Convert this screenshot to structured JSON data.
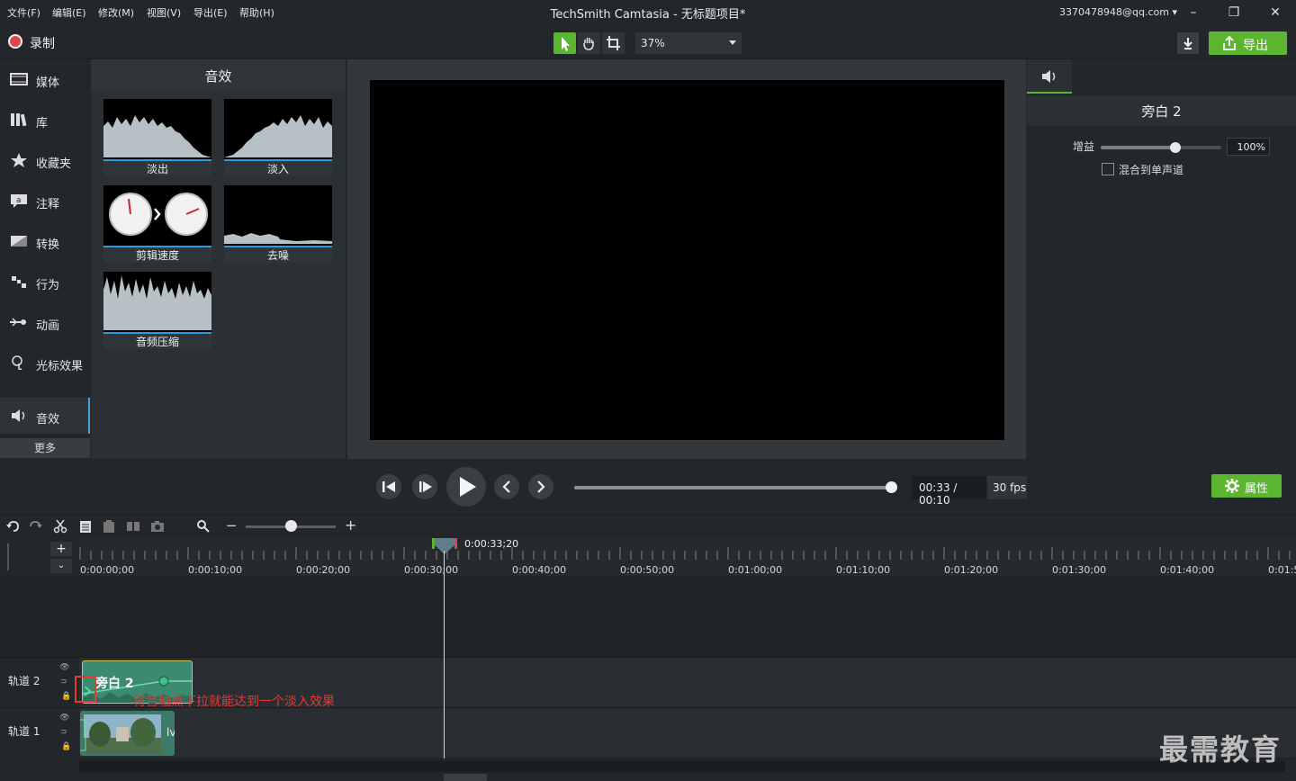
{
  "menu": [
    "文件(F)",
    "编辑(E)",
    "修改(M)",
    "视图(V)",
    "导出(E)",
    "帮助(H)"
  ],
  "title": "TechSmith Camtasia - 无标题项目*",
  "account": "3370478948@qq.com",
  "toolbar": {
    "record_label": "录制",
    "zoom": "37%",
    "export_label": "导出"
  },
  "sidebar": {
    "items": [
      "媒体",
      "库",
      "收藏夹",
      "注释",
      "转换",
      "行为",
      "动画",
      "光标效果",
      "音效"
    ],
    "more": "更多",
    "active": "音效"
  },
  "effects": {
    "title": "音效",
    "items": [
      "淡出",
      "淡入",
      "剪辑速度",
      "去噪",
      "音频压缩"
    ]
  },
  "properties": {
    "title": "旁白 2",
    "gain_label": "增益",
    "gain_value": "100%",
    "gain_level": 0.62,
    "mono_label": "混合到单声道",
    "mono_checked": false
  },
  "playback": {
    "time": "00:33 / 00:10",
    "fps": "30 fps",
    "progress": 1.0,
    "props_button": "属性"
  },
  "timeline": {
    "playhead_time": "0:00:33;20",
    "ruler": [
      "0:00:00;00",
      "0:00:10;00",
      "0:00:20;00",
      "0:00:30;00",
      "0:00:40;00",
      "0:00:50;00",
      "0:01:00;00",
      "0:01:10;00",
      "0:01:20;00",
      "0:01:30;00",
      "0:01:40;00",
      "0:01:5"
    ],
    "tracks": [
      {
        "name": "轨道 2",
        "clip_label": "旁白 2"
      },
      {
        "name": "轨道 1",
        "clip_label": "lv"
      }
    ],
    "annotation": "将音轴点下拉就能达到一个淡入效果"
  },
  "watermark": "最需教育",
  "colors": {
    "accent_green": "#5cb531",
    "record_red": "#e24545",
    "annotation_red": "#e53935",
    "selection_blue": "#2f9ae0"
  },
  "icons": [
    "record-icon",
    "pointer-icon",
    "hand-icon",
    "crop-icon",
    "download-icon",
    "export-icon",
    "gear-icon",
    "speaker-icon",
    "undo-icon",
    "redo-icon",
    "cut-icon",
    "copy-icon",
    "paste-icon",
    "split-icon",
    "snapshot-icon",
    "zoom-icon",
    "eye-icon",
    "lock-icon"
  ]
}
